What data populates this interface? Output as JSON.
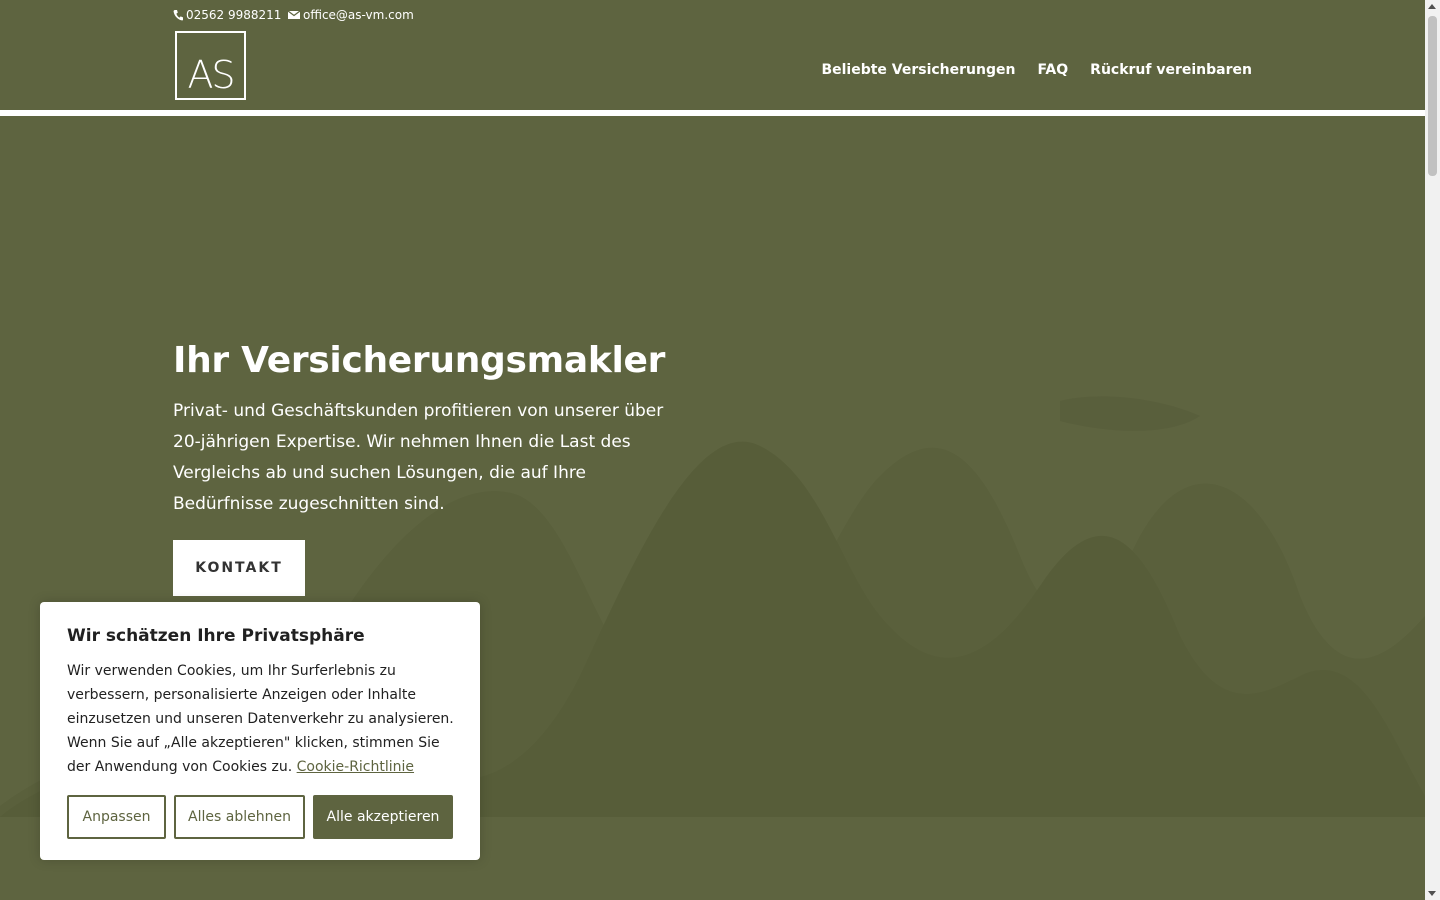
{
  "topbar": {
    "phone": "02562 9988211",
    "email": "office@as-vm.com"
  },
  "header": {
    "logo_text": "AS",
    "nav": [
      {
        "label": "Beliebte Versicherungen"
      },
      {
        "label": "FAQ"
      },
      {
        "label": "Rückruf vereinbaren"
      }
    ]
  },
  "hero": {
    "title": "Ihr Versicherungsmakler",
    "text": "Privat- und Geschäftskunden profitieren von unserer über 20-jährigen Expertise. Wir nehmen Ihnen die Last des Vergleichs ab und suchen Lösungen, die auf Ihre Bedürfnisse zugeschnitten sind.",
    "cta": "KONTAKT"
  },
  "cookie_banner": {
    "title": "Wir schätzen Ihre Privatsphäre",
    "text": "Wir verwenden Cookies, um Ihr Surferlebnis zu verbessern, personalisierte Anzeigen oder Inhalte einzusetzen und unseren Datenverkehr zu analysieren. Wenn Sie auf „Alle akzeptieren\" klicken, stimmen Sie der Anwendung von Cookies zu.",
    "link": "Cookie-Richtlinie",
    "buttons": {
      "customize": "Anpassen",
      "reject": "Alles ablehnen",
      "accept": "Alle akzeptieren"
    }
  },
  "colors": {
    "brand": "#5e6440",
    "white": "#ffffff"
  }
}
